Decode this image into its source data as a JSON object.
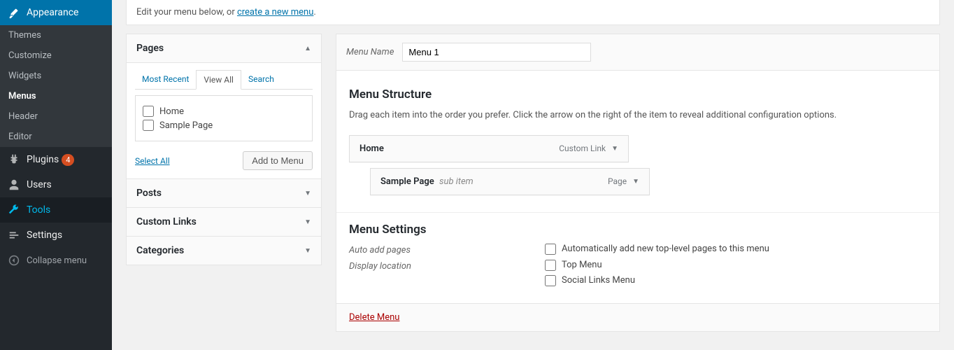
{
  "sidebar": {
    "active": {
      "label": "Appearance"
    },
    "sub": [
      "Themes",
      "Customize",
      "Widgets",
      "Menus",
      "Header",
      "Editor"
    ],
    "plugins": {
      "label": "Plugins",
      "count": "4"
    },
    "users": "Users",
    "tools": "Tools",
    "settings": "Settings",
    "collapse": "Collapse menu"
  },
  "hint": {
    "prefix": "Edit your menu below, or ",
    "link": "create a new menu",
    "suffix": "."
  },
  "acc": {
    "pages": {
      "title": "Pages",
      "tabs": {
        "recent": "Most Recent",
        "all": "View All",
        "search": "Search"
      },
      "items": [
        "Home",
        "Sample Page"
      ],
      "select_all": "Select All",
      "add": "Add to Menu"
    },
    "posts": "Posts",
    "custom_links": "Custom Links",
    "categories": "Categories"
  },
  "editor": {
    "name_label": "Menu Name",
    "name_value": "Menu 1",
    "structure_title": "Menu Structure",
    "structure_help": "Drag each item into the order you prefer. Click the arrow on the right of the item to reveal additional configuration options.",
    "items": [
      {
        "label": "Home",
        "type": "Custom Link",
        "sub": ""
      },
      {
        "label": "Sample Page",
        "type": "Page",
        "sub": "sub item"
      }
    ],
    "settings_title": "Menu Settings",
    "auto_add_label": "Auto add pages",
    "auto_add_opt": "Automatically add new top-level pages to this menu",
    "display_loc_label": "Display location",
    "display_loc_opts": [
      "Top Menu",
      "Social Links Menu"
    ],
    "delete": "Delete Menu"
  }
}
